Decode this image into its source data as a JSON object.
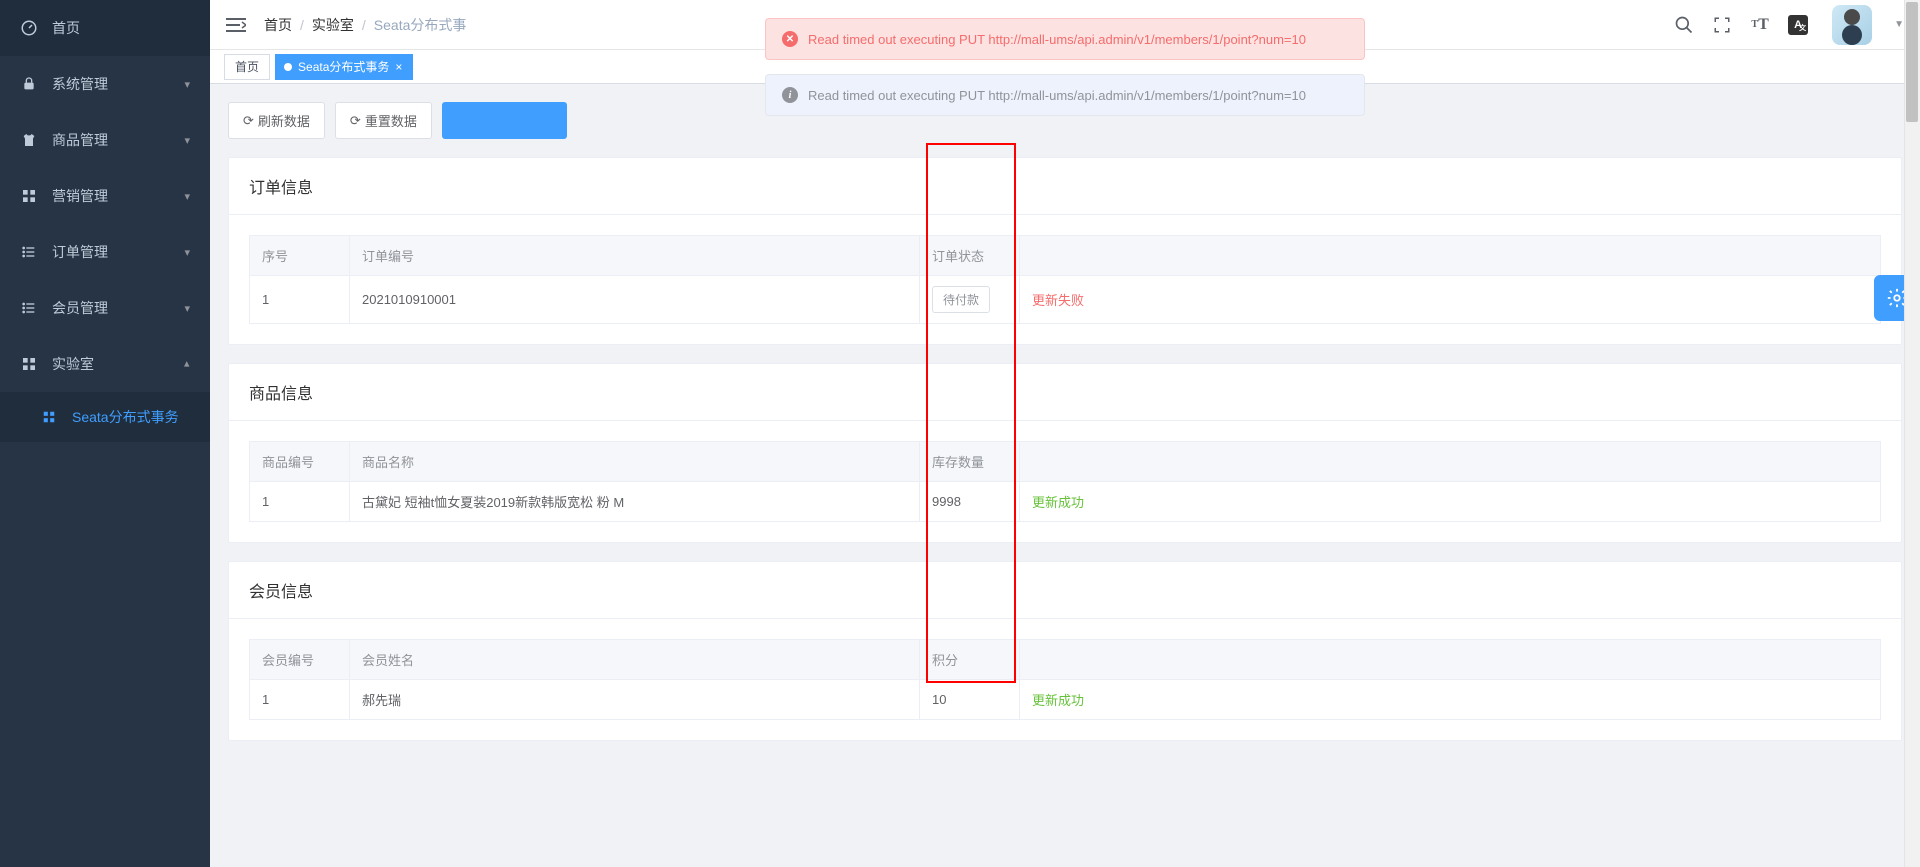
{
  "sidebar": {
    "items": [
      {
        "label": "首页",
        "icon": "dashboard"
      },
      {
        "label": "系统管理",
        "icon": "lock"
      },
      {
        "label": "商品管理",
        "icon": "shirt"
      },
      {
        "label": "营销管理",
        "icon": "grid"
      },
      {
        "label": "订单管理",
        "icon": "list"
      },
      {
        "label": "会员管理",
        "icon": "list"
      },
      {
        "label": "实验室",
        "icon": "grid",
        "expanded": true
      }
    ],
    "sub": {
      "label": "Seata分布式事务",
      "icon": "grid-small"
    }
  },
  "breadcrumb": {
    "items": [
      "首页",
      "实验室",
      "Seata分布式事务"
    ],
    "last_truncated": "Seata分布式事"
  },
  "tabs": {
    "home": "首页",
    "active": "Seata分布式事务"
  },
  "actions": {
    "refresh": "刷新数据",
    "reset": "重置数据"
  },
  "alerts": {
    "error": "Read timed out executing PUT http://mall-ums/api.admin/v1/members/1/point?num=10",
    "info": "Read timed out executing PUT http://mall-ums/api.admin/v1/members/1/point?num=10"
  },
  "panels": {
    "order": {
      "title": "订单信息",
      "cols": [
        "序号",
        "订单编号",
        "订单状态",
        ""
      ],
      "row": {
        "idx": "1",
        "code": "2021010910001",
        "status_btn": "待付款",
        "result": "更新失败"
      }
    },
    "product": {
      "title": "商品信息",
      "cols": [
        "商品编号",
        "商品名称",
        "库存数量",
        ""
      ],
      "row": {
        "idx": "1",
        "name": "古黛妃 短袖t恤女夏装2019新款韩版宽松 粉 M",
        "stock": "9998",
        "result": "更新成功"
      }
    },
    "member": {
      "title": "会员信息",
      "cols": [
        "会员编号",
        "会员姓名",
        "积分",
        ""
      ],
      "row": {
        "idx": "1",
        "name": "郝先瑞",
        "points": "10",
        "result": "更新成功"
      }
    }
  },
  "top_icons": {
    "lang": "A"
  }
}
